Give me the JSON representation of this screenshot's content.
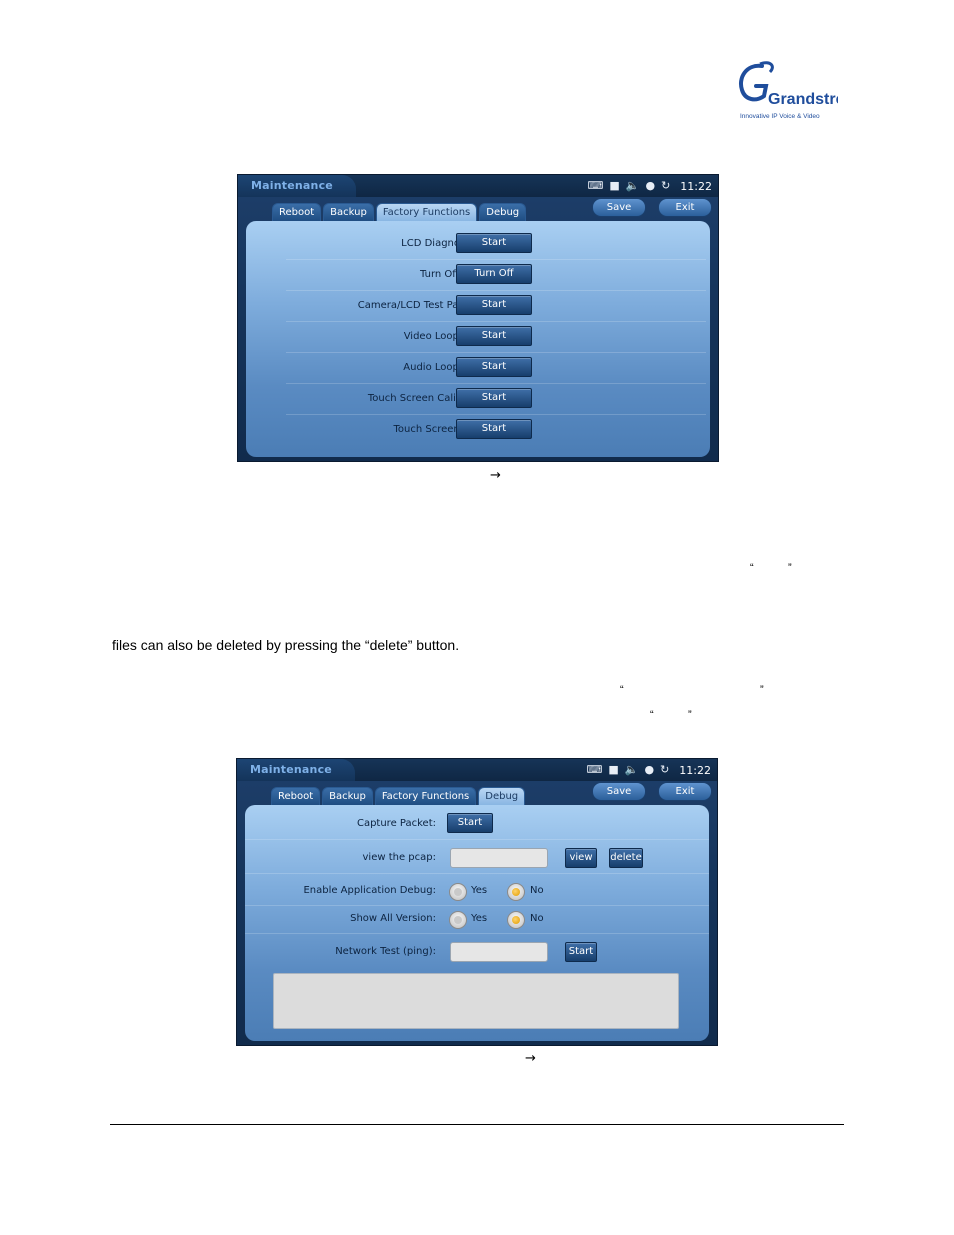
{
  "logo": {
    "brand": "Grandstream",
    "tagline": "Innovative IP Voice & Video"
  },
  "screens": {
    "factory": {
      "app_title": "Maintenance",
      "clock": "11:22",
      "tabs": [
        "Reboot",
        "Backup",
        "Factory Functions",
        "Debug"
      ],
      "active_tab": "Factory Functions",
      "save_label": "Save",
      "exit_label": "Exit",
      "rows": [
        {
          "label": "LCD Diagnostics:",
          "button": "Start"
        },
        {
          "label": "Turn Off LCD:",
          "button": "Turn Off"
        },
        {
          "label": "Camera/LCD Test Pattern:",
          "button": "Start"
        },
        {
          "label": "Video Loopback:",
          "button": "Start"
        },
        {
          "label": "Audio Loopback:",
          "button": "Start"
        },
        {
          "label": "Touch Screen Calibrate:",
          "button": "Start"
        },
        {
          "label": "Touch Screen Test:",
          "button": "Start"
        }
      ]
    },
    "debug": {
      "app_title": "Maintenance",
      "clock": "11:22",
      "tabs": [
        "Reboot",
        "Backup",
        "Factory Functions",
        "Debug"
      ],
      "active_tab": "Debug",
      "save_label": "Save",
      "exit_label": "Exit",
      "capture_label": "Capture Packet:",
      "capture_button": "Start",
      "pcap_label": "view the pcap:",
      "pcap_value": "",
      "view_button": "view",
      "delete_button": "delete",
      "app_debug_label": "Enable Application Debug:",
      "show_version_label": "Show All Version:",
      "yes_label": "Yes",
      "no_label": "No",
      "app_debug_selected": "No",
      "show_version_selected": "No",
      "ping_label": "Network Test (ping):",
      "ping_value": "",
      "ping_button": "Start",
      "output_text": ""
    }
  },
  "text": {
    "arrow": "→",
    "open_quote": "“",
    "close_quote": "”",
    "paragraph": "files can also be deleted by pressing the “delete” button."
  },
  "colors": {
    "panel_dark": "#16355c",
    "content_light": "#a9cff2",
    "radio_on": "#e09b00"
  }
}
